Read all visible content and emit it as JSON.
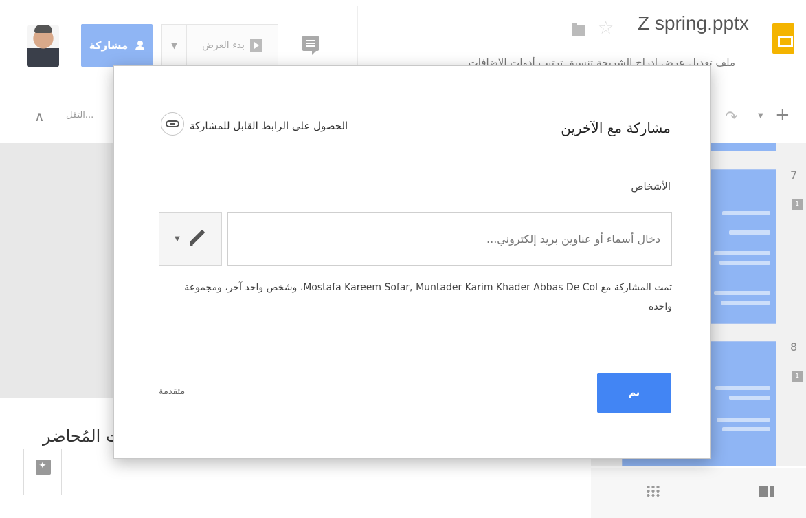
{
  "header": {
    "share_button_label": "مشاركة",
    "present_label": "بدء العرض",
    "doc_title": "Z spring.pptx",
    "menu_text": "ملف   تعديل   عرض   إدراج   الشريحة   تنسيق   ترتيب   أدوات   الإضافات"
  },
  "toolbar": {
    "more_label": "التقل..."
  },
  "notes": {
    "text": "ت المُحاضر"
  },
  "filmstrip": {
    "slides": [
      {
        "number": "7",
        "comments": "1"
      },
      {
        "number": "8",
        "comments": "1"
      }
    ]
  },
  "dialog": {
    "title": "مشاركة مع الآخرين",
    "get_link_label": "الحصول على الرابط القابل للمشاركة",
    "people_label": "الأشخاص",
    "input_placeholder": "دخال أسماء أو عناوين بريد إلكتروني...",
    "shared_with_text": "تمت المشاركة مع Mostafa Kareem Sofar, Muntader Karim Khader Abbas De Col، وشخص واحد آخر، ومجموعة واحدة",
    "done_label": "تم",
    "advanced_label": "متقدمة"
  },
  "colors": {
    "accent": "#4285f4",
    "share_button": "#8fb5f4",
    "slides_logo": "#f4b400"
  }
}
